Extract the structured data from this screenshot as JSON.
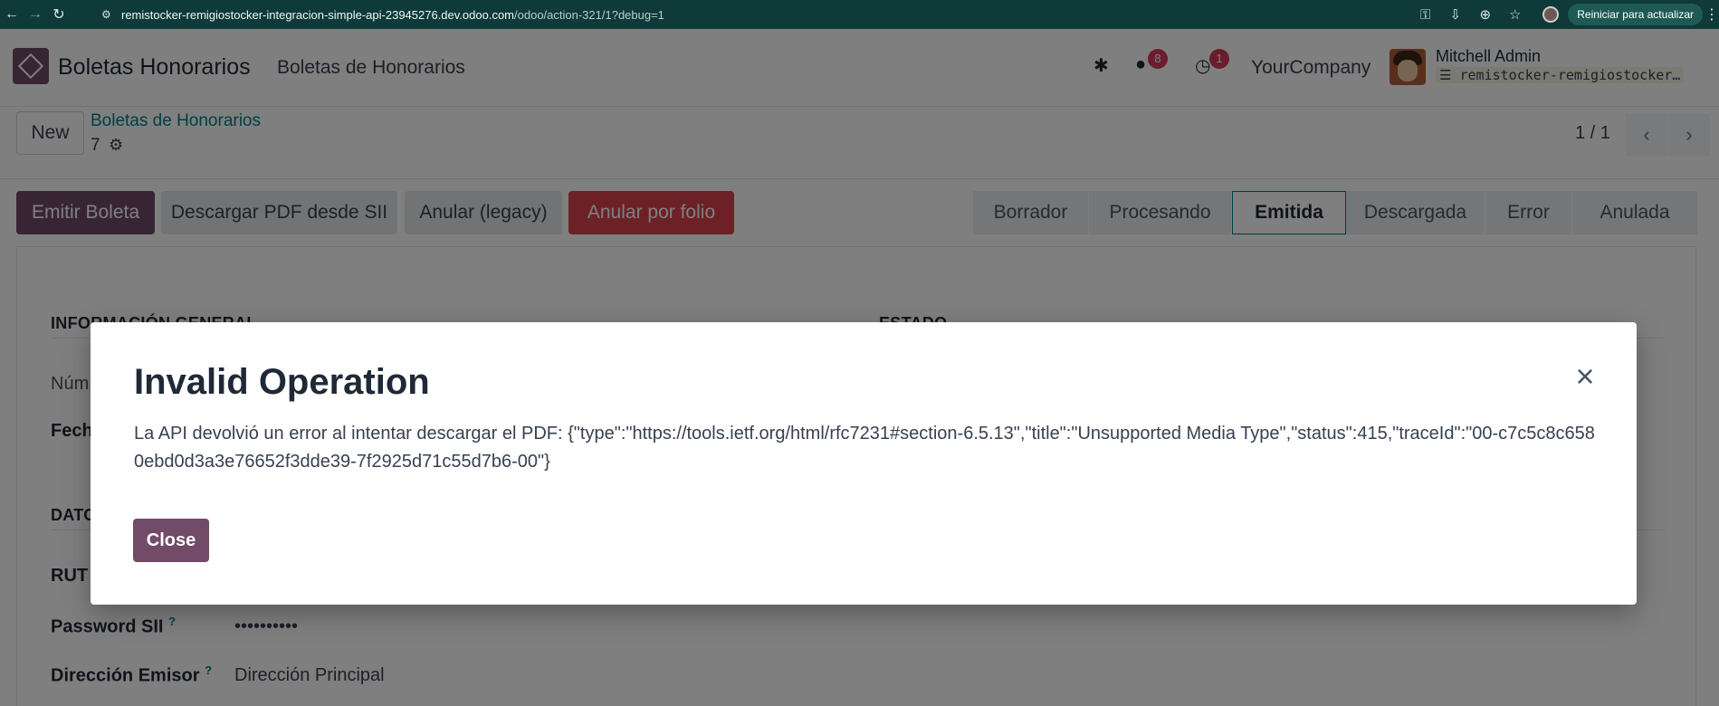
{
  "browser": {
    "url_host": "remistocker-remigiostocker-integracion-simple-api-23945276.dev.odoo.com",
    "url_path": "/odoo/action-321/1?debug=1",
    "update_label": "Reiniciar para actualizar"
  },
  "navbar": {
    "app_name": "Boletas Honorarios",
    "menu_item": "Boletas de Honorarios",
    "messages_count": "8",
    "activities_count": "1",
    "company": "YourCompany",
    "user_name": "Mitchell Admin",
    "database": "remistocker-remigiostocker…"
  },
  "control_panel": {
    "new_label": "New",
    "breadcrumb": "Boletas de Honorarios",
    "record_id": "7",
    "pager": "1 / 1"
  },
  "header": {
    "buttons": [
      "Emitir Boleta",
      "Descargar PDF desde SII",
      "Anular (legacy)",
      "Anular por folio"
    ],
    "stages": [
      "Borrador",
      "Procesando",
      "Emitida",
      "Descargada",
      "Error",
      "Anulada"
    ],
    "active_stage": "Emitida"
  },
  "form": {
    "section_general": "INFORMACIÓN GENERAL",
    "section_estado": "ESTADO",
    "label_numero": "Núm",
    "label_fecha": "Fech",
    "section_datos": "DATO",
    "label_rut": "RUT",
    "label_password": "Password SII",
    "value_password": "••••••••••",
    "label_direccion": "Dirección Emisor",
    "value_direccion": "Dirección Principal",
    "help_mark": "?"
  },
  "dialog": {
    "title": "Invalid Operation",
    "message": "La API devolvió un error al intentar descargar el PDF: {\"type\":\"https://tools.ietf.org/html/rfc7231#section-6.5.13\",\"title\":\"Unsupported Media Type\",\"status\":415,\"traceId\":\"00-c7c5c8c6580ebd0d3a3e76652f3dde39-7f2925d71c55d7b6-00\"}",
    "close_label": "Close"
  },
  "colors": {
    "brand": "#714b67",
    "accent": "#017e84",
    "danger": "#d9434f",
    "browser_chrome": "#0f3a3a"
  }
}
